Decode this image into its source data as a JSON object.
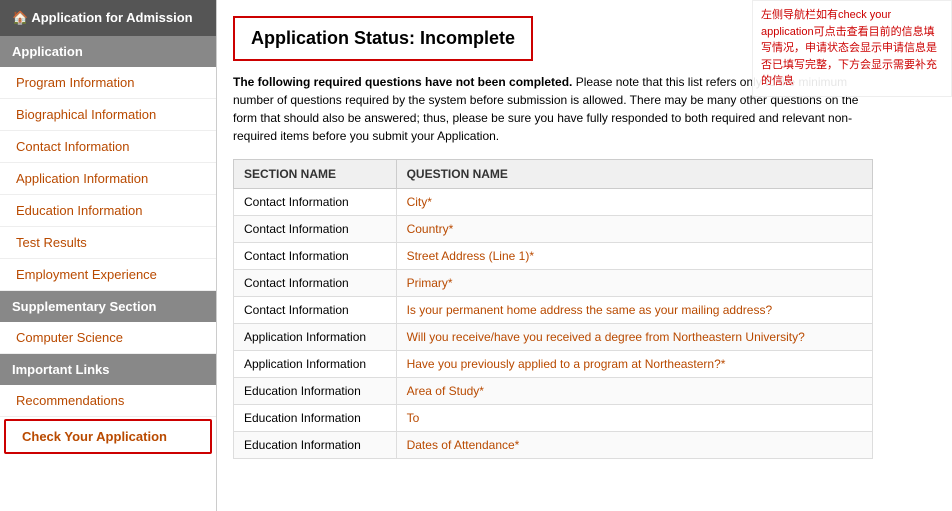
{
  "sidebar": {
    "header": "🏠 Application for Admission",
    "sections": [
      {
        "label": "Application",
        "type": "section",
        "items": [
          {
            "label": "Program Information",
            "active": false
          },
          {
            "label": "Biographical Information",
            "active": false
          },
          {
            "label": "Contact Information",
            "active": false
          },
          {
            "label": "Application Information",
            "active": false
          },
          {
            "label": "Education Information",
            "active": false
          },
          {
            "label": "Test Results",
            "active": false
          },
          {
            "label": "Employment Experience",
            "active": false
          }
        ]
      },
      {
        "label": "Supplementary Section",
        "type": "section",
        "items": [
          {
            "label": "Computer Science",
            "active": false
          }
        ]
      },
      {
        "label": "Important Links",
        "type": "section",
        "items": [
          {
            "label": "Recommendations",
            "active": false
          },
          {
            "label": "Check Your Application",
            "active": true
          }
        ]
      }
    ]
  },
  "main": {
    "status_title": "Application Status: Incomplete",
    "intro_bold": "The following required questions have not been completed.",
    "intro_rest": " Please note that this list refers only to the minimum number of questions required by the system before submission is allowed. There may be many other questions on the form that should also be answered; thus, please be sure you have fully responded to both required and relevant non-required items before you submit your Application.",
    "table": {
      "col1": "SECTION NAME",
      "col2": "QUESTION NAME",
      "rows": [
        {
          "section": "Contact Information",
          "question": "City*"
        },
        {
          "section": "Contact Information",
          "question": "Country*"
        },
        {
          "section": "Contact Information",
          "question": "Street Address (Line 1)*"
        },
        {
          "section": "Contact Information",
          "question": "Primary*"
        },
        {
          "section": "Contact Information",
          "question": "Is your permanent home address the same as your mailing address?"
        },
        {
          "section": "Application Information",
          "question": "Will you receive/have you received a degree from Northeastern University?"
        },
        {
          "section": "Application Information",
          "question": "Have you previously applied to a program at Northeastern?*"
        },
        {
          "section": "Education Information",
          "question": "Area of Study*"
        },
        {
          "section": "Education Information",
          "question": "To"
        },
        {
          "section": "Education Information",
          "question": "Dates of Attendance*"
        }
      ]
    }
  },
  "annotation": {
    "text": "左侧导航栏如有check your application可点击查看目前的信息填写情况，申请状态会显示申请信息是否已填写完整，下方会显示需要补充的信息"
  }
}
